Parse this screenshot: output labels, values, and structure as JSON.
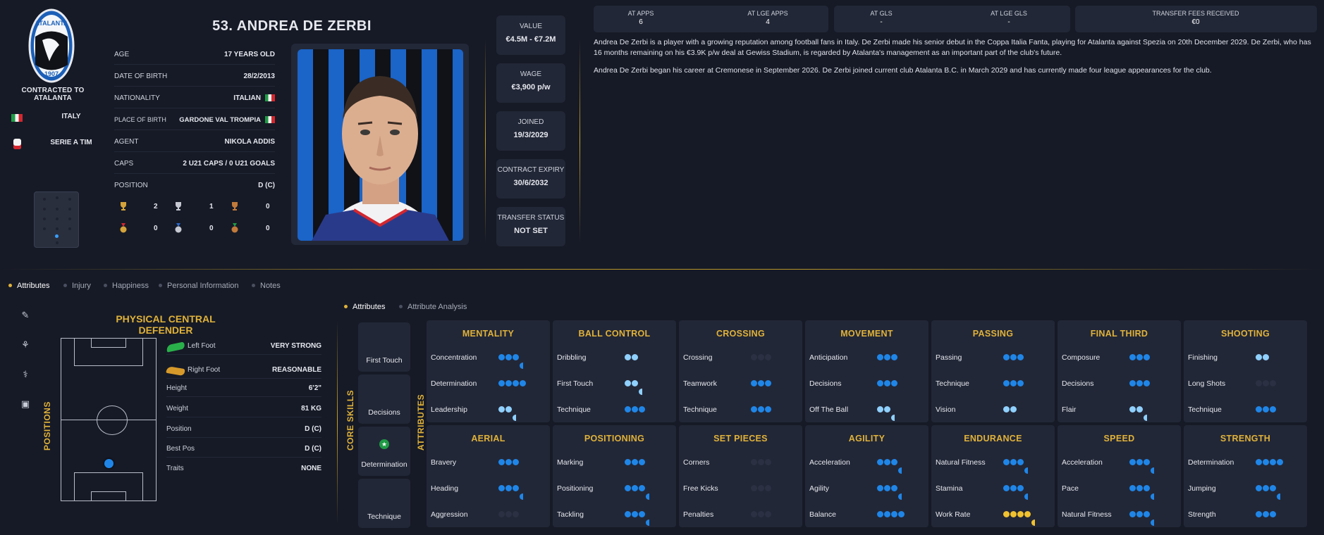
{
  "club": {
    "contracted_label": "CONTRACTED TO ATALANTA",
    "crest_text": "ATALANTA",
    "crest_year": "1907",
    "nation": "ITALY",
    "league": "SERIE A TIM"
  },
  "player": {
    "name": "53. ANDREA DE ZERBI",
    "info": [
      {
        "k": "AGE",
        "v": "17 YEARS OLD"
      },
      {
        "k": "DATE OF BIRTH",
        "v": "28/2/2013"
      },
      {
        "k": "NATIONALITY",
        "v": "ITALIAN"
      },
      {
        "k": "PLACE OF BIRTH",
        "v": "GARDONE VAL TROMPIA"
      },
      {
        "k": "AGENT",
        "v": "NIKOLA ADDIS"
      },
      {
        "k": "CAPS",
        "v": "2 U21 CAPS / 0 U21 GOALS"
      },
      {
        "k": "POSITION",
        "v": "D (C)"
      }
    ],
    "trophies": [
      "2",
      "1",
      "0"
    ],
    "medals": [
      "0",
      "0",
      "0"
    ]
  },
  "stats": [
    {
      "k": "VALUE",
      "v": "€4.5M - €7.2M"
    },
    {
      "k": "WAGE",
      "v": "€3,900 p/w"
    },
    {
      "k": "JOINED",
      "v": "19/3/2029"
    },
    {
      "k": "CONTRACT EXPIRY",
      "v": "30/6/2032"
    },
    {
      "k": "TRANSFER STATUS",
      "v": "NOT SET"
    }
  ],
  "top_stats": [
    {
      "k": "AT APPS",
      "v": "6"
    },
    {
      "k": "AT LGE APPS",
      "v": "4"
    },
    {
      "k": "AT GLS",
      "v": "-"
    },
    {
      "k": "AT LGE GLS",
      "v": "-"
    },
    {
      "k": "TRANSFER FEES RECEIVED",
      "v": "€0"
    }
  ],
  "bio": [
    "Andrea De Zerbi is a player with a growing reputation among football fans in Italy. De Zerbi made his senior debut in the Coppa Italia Fanta, playing for Atalanta against Spezia on 20th December 2029. De Zerbi, who has 16 months remaining on his €3.9K p/w deal at Gewiss Stadium, is regarded by Atalanta's management as an important part of the club's future.",
    "Andrea De Zerbi began his career at Cremonese in September 2026. De Zerbi joined current club Atalanta B.C. in March 2029 and has currently made four league appearances for the club."
  ],
  "tabs": [
    "Attributes",
    "Injury",
    "Happiness",
    "Personal Information",
    "Notes"
  ],
  "subtabs": [
    "Attributes",
    "Attribute Analysis"
  ],
  "role": "PHYSICAL CENTRAL DEFENDER",
  "positions_label": "POSITIONS",
  "core_label": "CORE SKILLS",
  "attributes_label": "ATTRIBUTES",
  "physical": [
    {
      "k": "Left Foot",
      "v": "VERY STRONG"
    },
    {
      "k": "Right Foot",
      "v": "REASONABLE"
    },
    {
      "k": "Height",
      "v": "6'2\""
    },
    {
      "k": "Weight",
      "v": "81 KG"
    },
    {
      "k": "Position",
      "v": "D (C)"
    },
    {
      "k": "Best Pos",
      "v": "D (C)"
    },
    {
      "k": "Traits",
      "v": "NONE"
    }
  ],
  "core_skills": [
    "First Touch",
    "Decisions",
    "Determination",
    "Technique"
  ],
  "attr_groups": [
    {
      "h": "MENTALITY",
      "rows": [
        [
          "Concentration",
          "bbbh"
        ],
        [
          "Determination",
          "bbbb"
        ],
        [
          "Leadership",
          "llh"
        ]
      ]
    },
    {
      "h": "BALL CONTROL",
      "rows": [
        [
          "Dribbling",
          "ll"
        ],
        [
          "First Touch",
          "llh"
        ],
        [
          "Technique",
          "bbb"
        ]
      ]
    },
    {
      "h": "CROSSING",
      "rows": [
        [
          "Crossing",
          ""
        ],
        [
          "Teamwork",
          "bbb"
        ],
        [
          "Technique",
          "bbb"
        ]
      ]
    },
    {
      "h": "MOVEMENT",
      "rows": [
        [
          "Anticipation",
          "bbb"
        ],
        [
          "Decisions",
          "bbb"
        ],
        [
          "Off The Ball",
          "llh"
        ]
      ]
    },
    {
      "h": "PASSING",
      "rows": [
        [
          "Passing",
          "bbb"
        ],
        [
          "Technique",
          "bbb"
        ],
        [
          "Vision",
          "ll"
        ]
      ]
    },
    {
      "h": "FINAL THIRD",
      "rows": [
        [
          "Composure",
          "bbb"
        ],
        [
          "Decisions",
          "bbb"
        ],
        [
          "Flair",
          "llh"
        ]
      ]
    },
    {
      "h": "SHOOTING",
      "rows": [
        [
          "Finishing",
          "ll"
        ],
        [
          "Long Shots",
          ""
        ],
        [
          "Technique",
          "bbb"
        ]
      ]
    },
    {
      "h": "AERIAL",
      "rows": [
        [
          "Bravery",
          "bbb"
        ],
        [
          "Heading",
          "bbbh"
        ],
        [
          "Aggression",
          ""
        ]
      ]
    },
    {
      "h": "POSITIONING",
      "rows": [
        [
          "Marking",
          "bbb"
        ],
        [
          "Positioning",
          "bbbh"
        ],
        [
          "Tackling",
          "bbbh"
        ]
      ]
    },
    {
      "h": "SET PIECES",
      "rows": [
        [
          "Corners",
          ""
        ],
        [
          "Free Kicks",
          ""
        ],
        [
          "Penalties",
          ""
        ]
      ]
    },
    {
      "h": "AGILITY",
      "rows": [
        [
          "Acceleration",
          "bbbh"
        ],
        [
          "Agility",
          "bbbh"
        ],
        [
          "Balance",
          "bbbb"
        ]
      ]
    },
    {
      "h": "ENDURANCE",
      "rows": [
        [
          "Natural Fitness",
          "bbbh"
        ],
        [
          "Stamina",
          "bbbh"
        ],
        [
          "Work Rate",
          "ggggh"
        ]
      ]
    },
    {
      "h": "SPEED",
      "rows": [
        [
          "Acceleration",
          "bbbh"
        ],
        [
          "Pace",
          "bbbh"
        ],
        [
          "Natural Fitness",
          "bbbh"
        ]
      ]
    },
    {
      "h": "STRENGTH",
      "rows": [
        [
          "Determination",
          "bbbb"
        ],
        [
          "Jumping",
          "bbbh"
        ],
        [
          "Strength",
          "bbb"
        ]
      ]
    }
  ],
  "colors": {
    "accent": "#e0b23a",
    "dot": "#1f86e8",
    "dot_light": "#8fd0ff",
    "bg": "#161a26",
    "card": "#222737"
  }
}
